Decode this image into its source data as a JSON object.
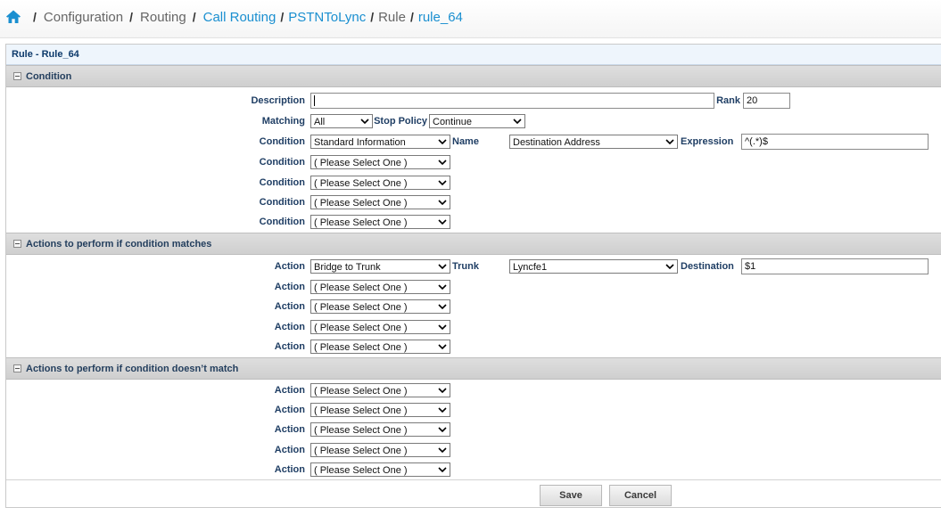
{
  "breadcrumb": {
    "items": [
      "Configuration",
      "Routing",
      "Call Routing",
      "PSTNToLync",
      "Rule",
      "rule_64"
    ]
  },
  "panel": {
    "title": "Rule - Rule_64"
  },
  "condition_section": {
    "title": "Condition",
    "description_label": "Description",
    "description_value": "",
    "rank_label": "Rank",
    "rank_value": "20",
    "matching_label": "Matching",
    "matching_value": "All",
    "stop_policy_label": "Stop Policy",
    "stop_policy_value": "Continue",
    "conditions": [
      {
        "label": "Condition",
        "value": "Standard Information",
        "name_label": "Name",
        "name_value": "Destination Address",
        "expression_label": "Expression",
        "expression_value": "^(.*)$"
      },
      {
        "label": "Condition",
        "value": "( Please Select One )"
      },
      {
        "label": "Condition",
        "value": "( Please Select One )"
      },
      {
        "label": "Condition",
        "value": "( Please Select One )"
      },
      {
        "label": "Condition",
        "value": "( Please Select One )"
      }
    ]
  },
  "match_actions_section": {
    "title": "Actions to perform if condition matches",
    "actions": [
      {
        "label": "Action",
        "value": "Bridge to Trunk",
        "trunk_label": "Trunk",
        "trunk_value": "Lyncfe1",
        "destination_label": "Destination",
        "destination_value": "$1"
      },
      {
        "label": "Action",
        "value": "( Please Select One )"
      },
      {
        "label": "Action",
        "value": "( Please Select One )"
      },
      {
        "label": "Action",
        "value": "( Please Select One )"
      },
      {
        "label": "Action",
        "value": "( Please Select One )"
      }
    ]
  },
  "nomatch_actions_section": {
    "title": "Actions to perform if condition doesn’t match",
    "actions": [
      {
        "label": "Action",
        "value": "( Please Select One )"
      },
      {
        "label": "Action",
        "value": "( Please Select One )"
      },
      {
        "label": "Action",
        "value": "( Please Select One )"
      },
      {
        "label": "Action",
        "value": "( Please Select One )"
      },
      {
        "label": "Action",
        "value": "( Please Select One )"
      }
    ]
  },
  "buttons": {
    "save": "Save",
    "cancel": "Cancel"
  },
  "colors": {
    "link": "#1a8fd0",
    "label": "#1f3e64",
    "section_bg": "#d4d4d4"
  },
  "icons": {
    "home": "home-icon",
    "dropdown": "chevron-down-icon",
    "collapse": "collapse-icon"
  }
}
